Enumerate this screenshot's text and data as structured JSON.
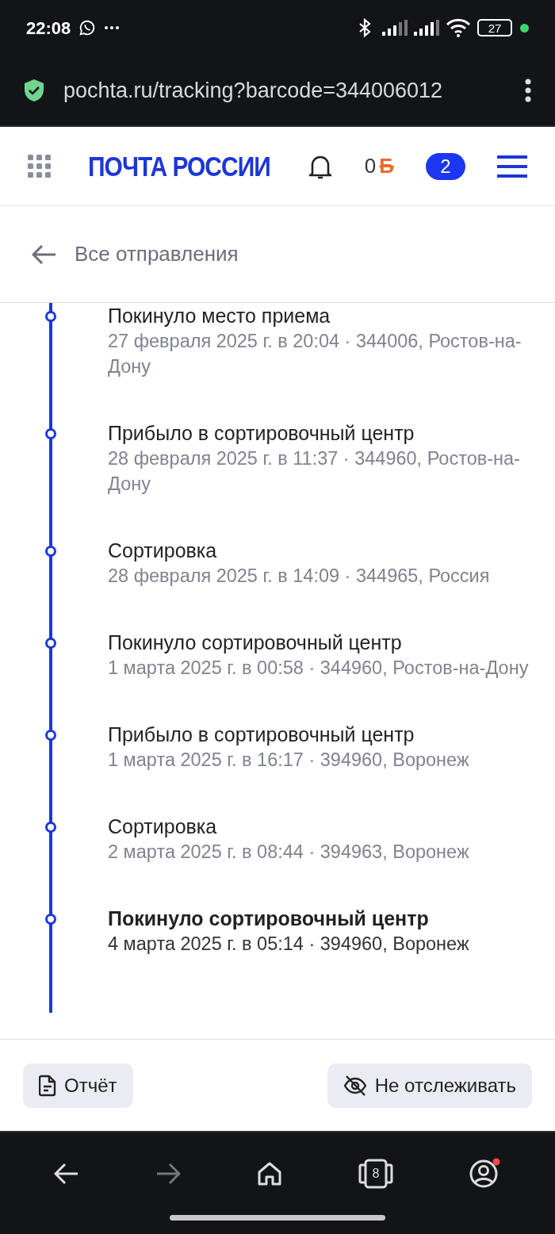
{
  "status_bar": {
    "time": "22:08",
    "battery": "27"
  },
  "browser": {
    "url": "pochta.ru/tracking?barcode=344006012",
    "tab_count": "8"
  },
  "header": {
    "logo": "ПОЧТА РОССИИ",
    "points": "0",
    "points_symbol": "Б",
    "badge": "2"
  },
  "back_link": "Все отправления",
  "events": [
    {
      "title": "Покинуло место приема",
      "details": "27 февраля 2025 г. в 20:04 · 344006, Ростов-на-Дону",
      "current": false
    },
    {
      "title": "Прибыло в сортировочный центр",
      "details": "28 февраля 2025 г. в 11:37 · 344960, Ростов-на-Дону",
      "current": false
    },
    {
      "title": "Сортировка",
      "details": "28 февраля 2025 г. в 14:09 · 344965, Россия",
      "current": false
    },
    {
      "title": "Покинуло сортировочный центр",
      "details": "1 марта 2025 г. в 00:58 · 344960, Ростов-на-Дону",
      "current": false
    },
    {
      "title": "Прибыло в сортировочный центр",
      "details": "1 марта 2025 г. в 16:17 · 394960, Воронеж",
      "current": false
    },
    {
      "title": "Сортировка",
      "details": "2 марта 2025 г. в 08:44 · 394963, Воронеж",
      "current": false
    },
    {
      "title": "Покинуло сортировочный центр",
      "details": "4 марта 2025 г. в 05:14 · 394960, Воронеж",
      "current": true
    }
  ],
  "actions": [
    {
      "label": "Отчёт",
      "kind": "report"
    },
    {
      "label": "Не отслеживать",
      "kind": "untrack"
    }
  ]
}
